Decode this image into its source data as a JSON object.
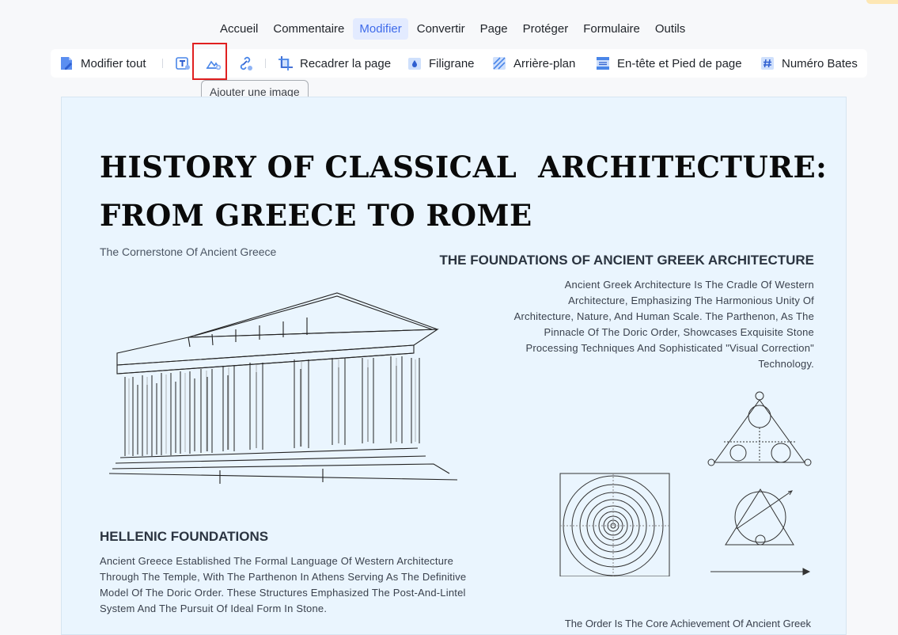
{
  "menu": {
    "items": [
      {
        "label": "Accueil"
      },
      {
        "label": "Commentaire"
      },
      {
        "label": "Modifier",
        "active": true
      },
      {
        "label": "Convertir"
      },
      {
        "label": "Page"
      },
      {
        "label": "Protéger"
      },
      {
        "label": "Formulaire"
      },
      {
        "label": "Outils"
      }
    ]
  },
  "toolbar": {
    "edit_all": "Modifier tout",
    "crop_page": "Recadrer la page",
    "watermark": "Filigrane",
    "background": "Arrière-plan",
    "header_footer": "En-tête et Pied de page",
    "bates_number": "Numéro Bates",
    "add_image_tooltip": "Ajouter une image"
  },
  "document": {
    "title_line1": "HISTORY OF CLASSICAL  ARCHITECTURE:",
    "title_line2": "FROM GREECE TO ROME",
    "subtitle": "The Cornerstone Of Ancient Greece",
    "right_heading": "THE FOUNDATIONS OF ANCIENT GREEK ARCHITECTURE",
    "right_paragraph": "Ancient Greek Architecture Is The Cradle Of Western Architecture, Emphasizing The Harmonious Unity Of Architecture, Nature, And Human Scale. The Parthenon, As The Pinnacle Of The Doric Order, Showcases Exquisite Stone Processing Techniques And Sophisticated \"Visual Correction\" Technology.",
    "left_heading": "HELLENIC FOUNDATIONS",
    "left_paragraph": "Ancient Greece Established The Formal Language Of Western Architecture Through The Temple, With The Parthenon In Athens Serving As The Definitive Model Of The Doric Order. These Structures Emphasized The Post-And-Lintel System And The Pursuit Of Ideal Form In Stone.",
    "bottom_paragraph": "The Order Is The Core Achievement Of Ancient Greek"
  },
  "colors": {
    "accent": "#3f6bea",
    "accent_bg": "#e3ebff",
    "highlight_box": "#e02020",
    "page_bg": "#eaf5fe",
    "icon_blue": "#4a86e8"
  }
}
